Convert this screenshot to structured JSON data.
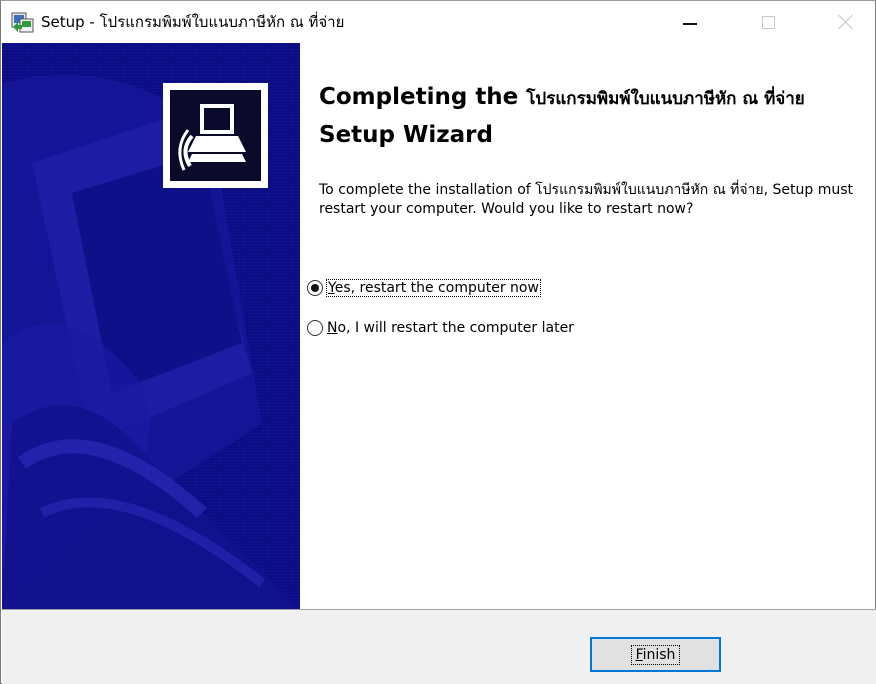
{
  "window": {
    "title": "Setup - โปรแกรมพิมพ์ใบแนบภาษีหัก ณ ที่จ่าย",
    "icon": "setup-installer-icon"
  },
  "titlebar_buttons": {
    "minimize": "minimize-icon",
    "maximize": "maximize-icon",
    "close": "close-icon"
  },
  "sidebar": {
    "emblem_icon": "computer-install-icon",
    "background_color": "#0c0c84"
  },
  "content": {
    "heading_prefix": "Completing the ",
    "heading_product": "โปรแกรมพิมพ์ใบแนบภาษีหัก ณ ที่จ่าย",
    "heading_suffix": " Setup Wizard",
    "description": "To complete the installation of โปรแกรมพิมพ์ใบแนบภาษีหัก ณ ที่จ่าย, Setup must restart your computer. Would you like to restart now?",
    "options": [
      {
        "mnemonic": "Y",
        "label_rest": "es, restart the computer now",
        "checked": true
      },
      {
        "mnemonic": "N",
        "label_rest": "o, I will restart the computer later",
        "checked": false
      }
    ]
  },
  "footer": {
    "finish_mnemonic": "F",
    "finish_rest": "inish",
    "accent_color": "#0078d7"
  }
}
